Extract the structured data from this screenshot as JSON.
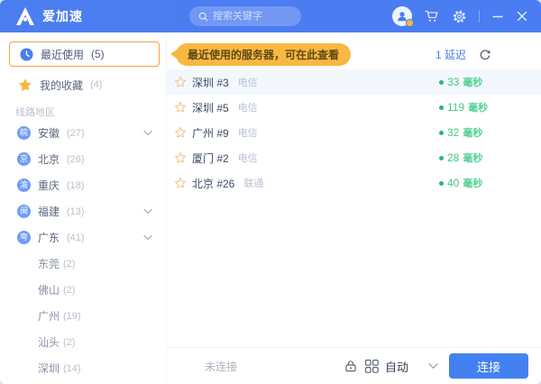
{
  "topbar": {
    "logo_text": "爱加速",
    "search_placeholder": "搜索关键字"
  },
  "sidebar": {
    "recent": {
      "label": "最近使用",
      "count": "(5)"
    },
    "favorites": {
      "label": "我的收藏",
      "count": "(4)"
    },
    "section_label": "线路地区",
    "regions": [
      {
        "abbr": "皖",
        "name": "安徽",
        "count": "(27)"
      },
      {
        "abbr": "京",
        "name": "北京",
        "count": "(26)"
      },
      {
        "abbr": "渝",
        "name": "重庆",
        "count": "(18)"
      },
      {
        "abbr": "闽",
        "name": "福建",
        "count": "(13)"
      },
      {
        "abbr": "粤",
        "name": "广东",
        "count": "(41)"
      }
    ],
    "cities": [
      {
        "name": "东莞",
        "count": "(2)"
      },
      {
        "name": "佛山",
        "count": "(2)"
      },
      {
        "name": "广州",
        "count": "(19)"
      },
      {
        "name": "汕头",
        "count": "(2)"
      },
      {
        "name": "深圳",
        "count": "(14)"
      }
    ]
  },
  "main": {
    "tooltip": "最近使用的服务器，可在此查看",
    "latency_header": {
      "prefix": "1",
      "label": "延迟"
    },
    "servers": [
      {
        "name": "深圳 #3",
        "carrier": "电信",
        "latency": "33",
        "unit": "毫秒"
      },
      {
        "name": "深圳 #5",
        "carrier": "电信",
        "latency": "119",
        "unit": "毫秒"
      },
      {
        "name": "广州 #9",
        "carrier": "电信",
        "latency": "32",
        "unit": "毫秒"
      },
      {
        "name": "厦门 #2",
        "carrier": "电信",
        "latency": "28",
        "unit": "毫秒"
      },
      {
        "name": "北京 #26",
        "carrier": "联通",
        "latency": "40",
        "unit": "毫秒"
      }
    ]
  },
  "footer": {
    "status": "未连接",
    "mode": "自动",
    "connect_label": "连接"
  },
  "colors": {
    "topbar_blue": "#4c7df1",
    "accent_blue": "#4a7df0",
    "selected_border_orange": "#f7a53c",
    "tooltip_amber": "#f9b842",
    "latency_green": "#3ecb81",
    "star_yellow": "#f6b93d"
  }
}
